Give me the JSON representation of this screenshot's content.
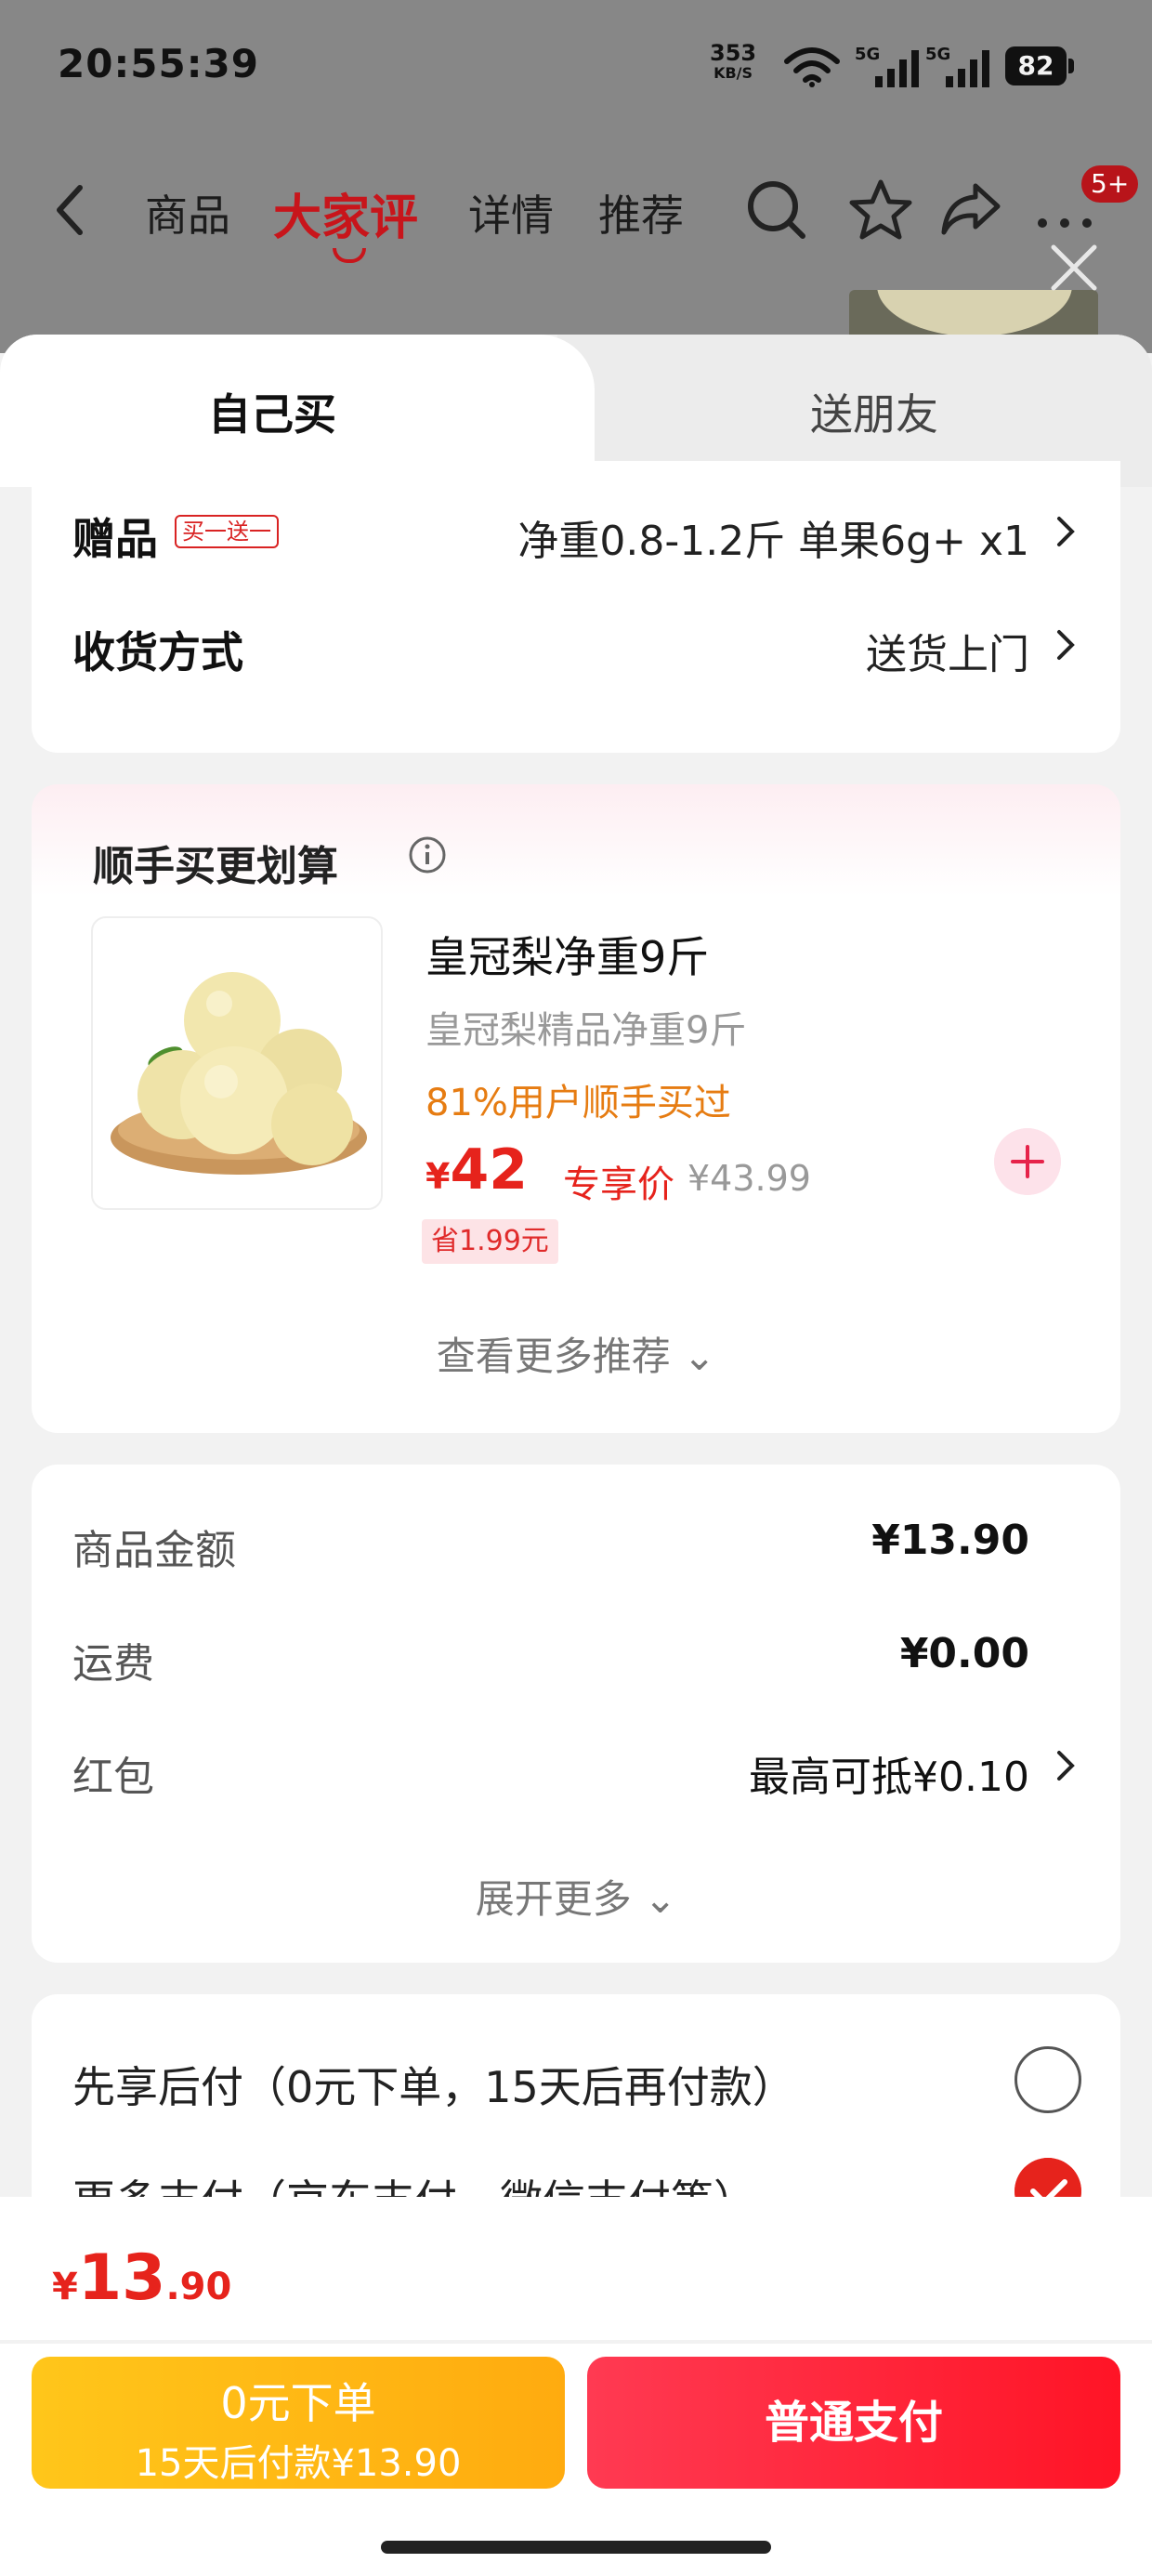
{
  "status_bar": {
    "time": "20:55:39",
    "net_speed": "353",
    "net_unit": "KB/S",
    "signal1_label": "5G",
    "signal2_label": "5G",
    "battery": "82"
  },
  "nav": {
    "tabs": [
      "商品",
      "大家评",
      "详情",
      "推荐"
    ],
    "active_tab": "大家评",
    "badge": "5+"
  },
  "sheet_tabs": {
    "self": "自己买",
    "friend": "送朋友"
  },
  "gift": {
    "label": "赠品",
    "tag": "买一送一",
    "value": "净重0.8-1.2斤 单果6g+ x1"
  },
  "delivery": {
    "label": "收货方式",
    "value": "送货上门"
  },
  "recommend": {
    "title": "顺手买更划算",
    "product_name": "皇冠梨净重9斤",
    "product_sub": "皇冠梨精品净重9斤",
    "percent_text": "81%用户顺手买过",
    "price_symbol": "¥",
    "price": "42",
    "price_tag": "专享价",
    "original_price": "¥43.99",
    "save": "省1.99元",
    "more": "查看更多推荐 ⌄"
  },
  "fees": {
    "goods_label": "商品金额",
    "goods_value": "¥13.90",
    "shipping_label": "运费",
    "shipping_value": "¥0.00",
    "redpacket_label": "红包",
    "redpacket_value": "最高可抵¥0.10",
    "expand": "展开更多 ⌄"
  },
  "payment": {
    "option1": "先享后付（0元下单，15天后再付款）",
    "option2": "更多支付（京东支付、微信支付等）"
  },
  "bottom": {
    "total_symbol": "¥",
    "total_int": "13",
    "total_dec": ".90",
    "btn_left_line1": "0元下单",
    "btn_left_line2": "15天后付款¥13.90",
    "btn_right": "普通支付"
  },
  "colors": {
    "accent_red": "#e6231c",
    "nav_active": "#c8151b",
    "orange_text": "#e67c12",
    "yellow_button": "#ffbb14"
  }
}
